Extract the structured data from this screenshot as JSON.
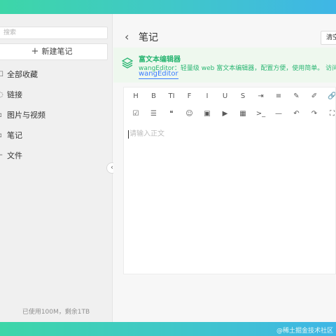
{
  "sidebar": {
    "search_placeholder": "搜索",
    "new_note": "新建笔记",
    "items": [
      {
        "label": "全部收藏",
        "icon": "star-icon"
      },
      {
        "label": "链接",
        "icon": "link-icon"
      },
      {
        "label": "图片与视频",
        "icon": "image-icon"
      },
      {
        "label": "笔记",
        "icon": "note-icon"
      },
      {
        "label": "文件",
        "icon": "file-icon"
      }
    ],
    "storage": "已使用100M，剩余1TB"
  },
  "main": {
    "title": "笔记",
    "clear_button": "清空",
    "banner": {
      "title": "富文本编辑器",
      "desc": "wangEditor：轻量级 web 富文本编辑器，配置方便，使用简单。 访问地址",
      "link": "wangEditor"
    },
    "editor": {
      "placeholder": "请输入正文",
      "toolbar_row1": [
        "heading-icon",
        "bold-icon",
        "font-size-icon",
        "font-family-icon",
        "italic-icon",
        "underline-icon",
        "strikethrough-icon",
        "indent-icon",
        "line-height-icon",
        "font-color-icon",
        "background-color-icon",
        "link-icon"
      ],
      "toolbar_row1_labels": [
        "H",
        "B",
        "TI",
        "F",
        "I",
        "U",
        "S",
        "⇥",
        "≡",
        "✎",
        "✐",
        "🔗"
      ],
      "toolbar_row2": [
        "todo-icon",
        "align-icon",
        "quote-icon",
        "emoji-icon",
        "image-icon",
        "video-icon",
        "table-icon",
        "code-icon",
        "divider-icon",
        "undo-icon",
        "redo-icon",
        "fullscreen-icon"
      ],
      "toolbar_row2_labels": [
        "☑",
        "☰",
        "❝",
        "☺",
        "▣",
        "▶",
        "▦",
        ">_",
        "—",
        "↶",
        "↷",
        "⛶"
      ]
    }
  },
  "watermark": "@稀土掘金技术社区",
  "colors": {
    "accent": "#2bb673",
    "link": "#3b7cff",
    "gradient_start": "#3dd6a8",
    "gradient_end": "#3fb6e6"
  }
}
